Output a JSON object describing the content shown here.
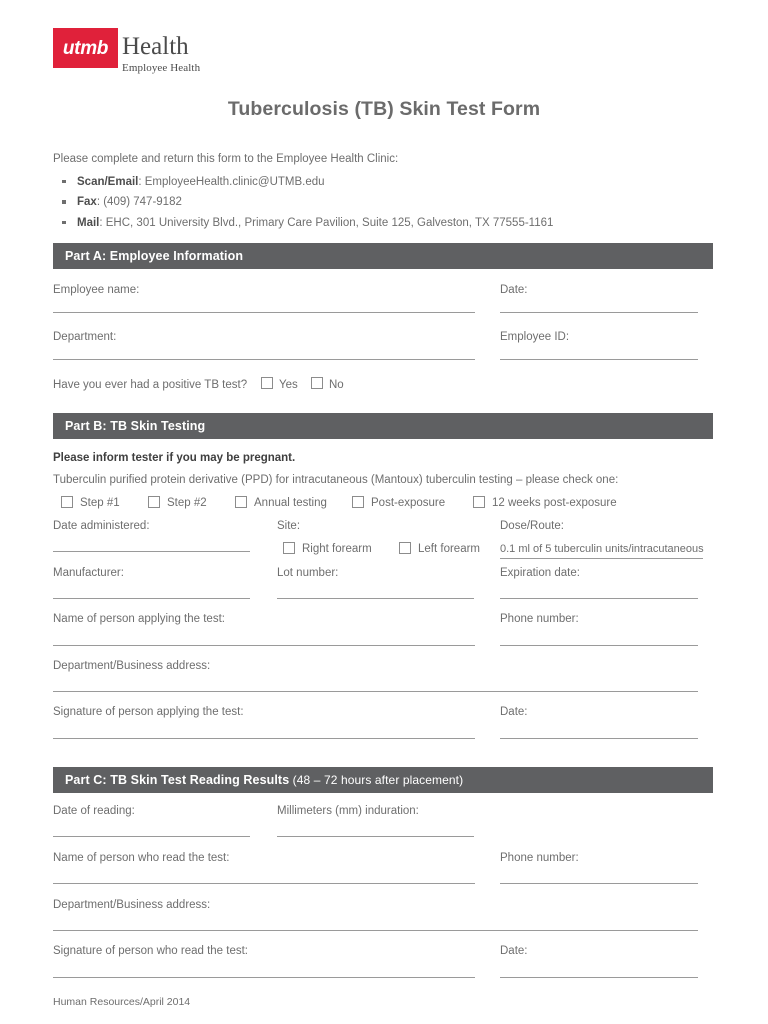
{
  "logo": {
    "mark_text": "utmb",
    "word": "Health",
    "subword": "Employee Health",
    "mark_color": "#e0213a"
  },
  "title": "Tuberculosis (TB) Skin Test Form",
  "intro": {
    "lead": "Please complete and return this form to the Employee Health Clinic:",
    "items": [
      {
        "label": "Scan/Email",
        "value": ": EmployeeHealth.clinic@UTMB.edu"
      },
      {
        "label": "Fax",
        "value": ": (409) 747-9182"
      },
      {
        "label": "Mail",
        "value": ": EHC, 301 University Blvd., Primary Care Pavilion, Suite 125, Galveston, TX 77555-1161"
      }
    ]
  },
  "part_a": {
    "bar": "Part A: Employee Information",
    "employee_name": "Employee name:",
    "date": "Date:",
    "department": "Department:",
    "employee_id": "Employee ID:",
    "positive_question": "Have you ever had a positive TB test?",
    "yes": "Yes",
    "no": "No"
  },
  "part_b": {
    "bar": "Part B: TB Skin Testing",
    "pregnant_notice": "Please inform tester if you may be pregnant.",
    "ppd_instruction": "Tuberculin purified protein derivative (PPD) for intracutaneous (Mantoux) tubercul​in testing – please check one:",
    "options": [
      "Step #1",
      "Step #2",
      "Annual testing",
      "Post-exposure",
      "12 weeks post-exposure"
    ],
    "date_administered": "Date administered:",
    "site": "Site:",
    "dose_route": "Dose/Route:",
    "right_forearm": "Right forearm",
    "left_forearm": "Left forearm",
    "dose_value": "0.1 ml of 5 tuberculin units/intracutaneous",
    "manufacturer": "Manufacturer:",
    "lot_number": "Lot number:",
    "expiration_date": "Expiration date:",
    "name_applying": "Name of person applying the test:",
    "phone_number": "Phone number:",
    "dept_address": "Department/Business address:",
    "signature_applying": "Signature of person applying the test:",
    "date": "Date:"
  },
  "part_c": {
    "bar_bold": "Part C: TB Skin Test Reading Results",
    "bar_sub": " (48 – 72 hours after placement)",
    "date_of_reading": "Date of reading:",
    "mm_induration": "Millimeters (mm) induration:",
    "name_read": "Name of person who read the test:",
    "phone_number": "Phone number:",
    "dept_address": "Department/Business address:",
    "signature_read": "Signature of person who read the test:",
    "date": "Date:"
  },
  "footer": "Human Resources/April 2014"
}
